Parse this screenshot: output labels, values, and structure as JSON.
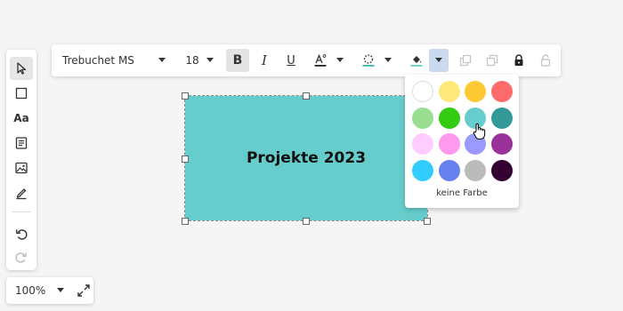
{
  "toolbar": {
    "font_family": "Trebuchet MS",
    "font_size": "18",
    "bold": "B",
    "italic": "I",
    "underline": "U",
    "text_color_accent": "#222222",
    "border_accent": "#3bb7b4",
    "fill_accent": "#67cdcc"
  },
  "shape": {
    "label": "Projekte 2023",
    "fill": "#67cdcc"
  },
  "zoom": {
    "value": "100%"
  },
  "picker": {
    "no_color_label": "keine Farbe",
    "swatches": [
      [
        "#ffffff",
        "#ffe97a",
        "#ffc933",
        "#ff6b6b"
      ],
      [
        "#99dd91",
        "#33cc11",
        "#67cdcc",
        "#339999"
      ],
      [
        "#ffccff",
        "#ff99ee",
        "#9999ff",
        "#993399"
      ],
      [
        "#33ccff",
        "#6680ee",
        "#bbbbbb",
        "#330033"
      ]
    ]
  }
}
